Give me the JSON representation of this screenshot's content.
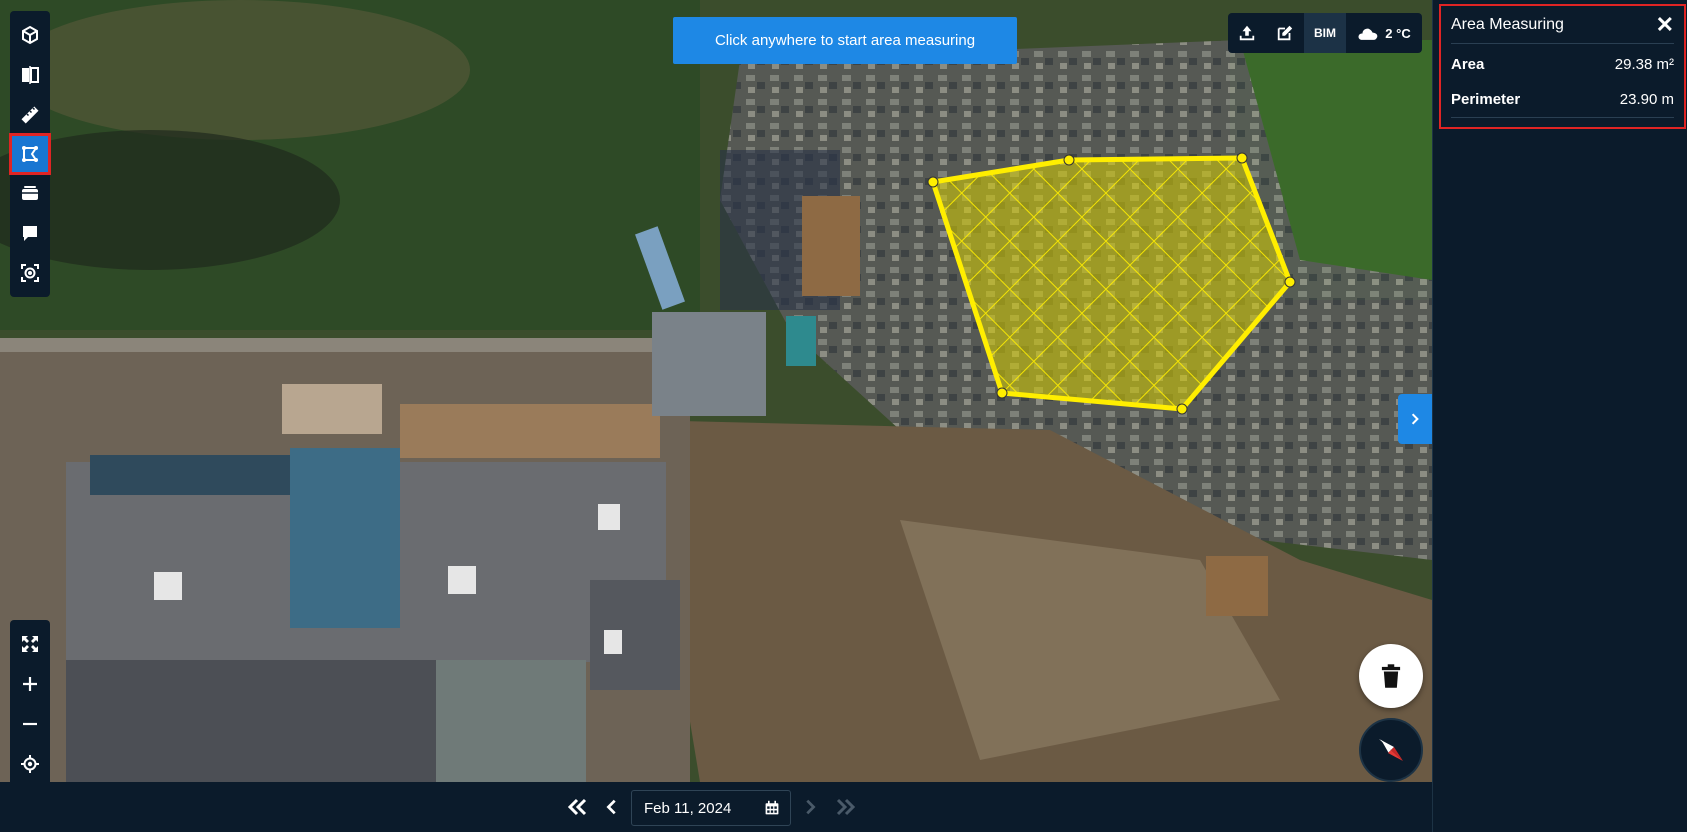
{
  "hint": {
    "text": "Click anywhere to start area measuring"
  },
  "topbar": {
    "bim_label": "BIM",
    "temperature": "2 °C"
  },
  "panel": {
    "title": "Area Measuring",
    "close_symbol": "✕",
    "rows": [
      {
        "label": "Area",
        "value": "29.38 m²"
      },
      {
        "label": "Perimeter",
        "value": "23.90 m"
      }
    ]
  },
  "timeline": {
    "date": "Feb 11, 2024"
  },
  "colors": {
    "accent": "#1e88e5",
    "panel_bg": "#0b1b2b",
    "highlight": "#e02424",
    "measure_polygon": "#ffee00"
  },
  "icons": {
    "left_tools": [
      "cube-icon",
      "compare-icon",
      "ruler-icon",
      "area-measure-icon",
      "layers-icon",
      "comment-icon",
      "capture-icon"
    ],
    "left_view": [
      "fullscreen-icon",
      "zoom-in-icon",
      "zoom-out-icon",
      "locate-icon"
    ],
    "top": [
      "upload-icon",
      "edit-icon",
      "cloud-icon"
    ]
  }
}
